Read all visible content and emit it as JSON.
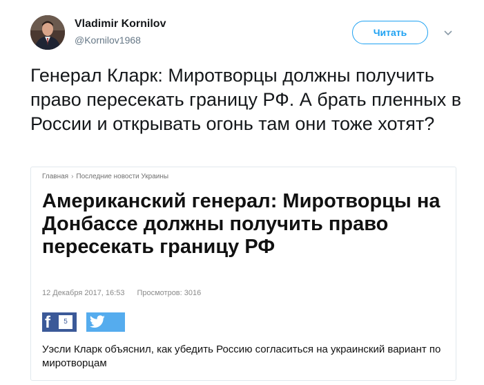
{
  "author": {
    "name": "Vladimir Kornilov",
    "handle": "@Kornilov1968",
    "avatar_icon": "user-avatar-photo"
  },
  "follow_button": {
    "label": "Читать",
    "color": "#1da1f2"
  },
  "menu_icon": "chevron-down-icon",
  "tweet": {
    "text": "Генерал Кларк: Миротворцы должны получить право пересекать границу РФ. А брать пленных в России и открывать огонь там они тоже хотят?"
  },
  "card": {
    "breadcrumb": [
      "Главная",
      "Последние новости Украины"
    ],
    "breadcrumb_separator": "›",
    "headline": "Американский генерал: Миротворцы на Донбассе должны получить право пересекать границу РФ",
    "date": "12 Декабря 2017, 16:53",
    "views": "Просмотров: 3016",
    "facebook_letter": "f",
    "facebook_count": "5",
    "lead": "Уэсли Кларк объяснил, как убедить Россию согласиться на украинский вариант по миротворцам",
    "colors": {
      "facebook": "#3b5998",
      "twitter": "#55acee"
    }
  }
}
